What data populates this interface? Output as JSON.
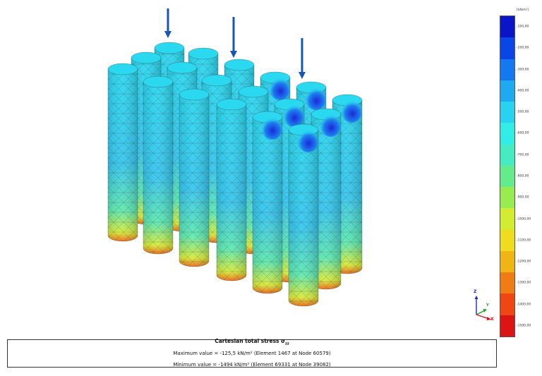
{
  "legend": {
    "unit": "[kN/m²]",
    "ticks": [
      "-100,00",
      "-200,00",
      "-300,00",
      "-400,00",
      "-500,00",
      "-600,00",
      "-700,00",
      "-800,00",
      "-900,00",
      "-1000,00",
      "-1100,00",
      "-1200,00",
      "-1300,00",
      "-1400,00",
      "-1500,00"
    ],
    "colors": [
      "#0a14c8",
      "#0a46e6",
      "#1478f0",
      "#1eaaf0",
      "#28d2f0",
      "#32ece6",
      "#46ecc0",
      "#64ec8c",
      "#96ec50",
      "#d2ec32",
      "#f0dc1e",
      "#f0b414",
      "#f07d14",
      "#f04614",
      "#dc1414"
    ]
  },
  "model": {
    "pile_colors": {
      "top": "#2ad8f0",
      "body": "#36c6ee",
      "lower": "#5ee8b0",
      "bottom": "#d8ea3a",
      "base": "#ee6a18",
      "cap_hot": "#1a2ad8",
      "mesh": "#3a3a3a"
    },
    "load_arrow_color": "#1856b4"
  },
  "axes": {
    "z": "Z",
    "y": "Y",
    "x": "X"
  },
  "results": {
    "title_main": "Cartesian total stress σ",
    "title_sub": "zz",
    "max_line": "Maximum value = -125,5 kN/m² (Element 1467 at Node 60579)",
    "min_line": "Minimum value = -1494 kN/m² (Element 69331 at Node 39082)"
  }
}
